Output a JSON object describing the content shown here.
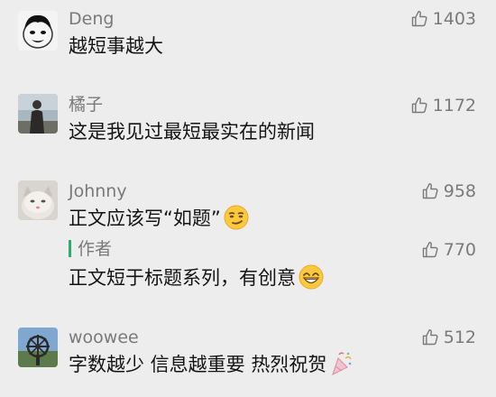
{
  "comments": [
    {
      "name": "Deng",
      "text": "越短事越大",
      "likes": "1403",
      "avatar": "meme-face-avatar"
    },
    {
      "name": "橘子",
      "text": "这是我见过最短最实在的新闻",
      "likes": "1172",
      "avatar": "person-photo-avatar"
    },
    {
      "name": "Johnny",
      "text": "正文应该写“如题”",
      "likes": "958",
      "avatar": "cat-photo-avatar",
      "emoji": "smirk-emoji"
    },
    {
      "name": "作者",
      "text": "正文短于标题系列，有创意",
      "likes": "770",
      "is_author_reply": true,
      "emoji": "grin-emoji"
    },
    {
      "name": "woowee",
      "text": "字数越少 信息越重要 热烈祝贺",
      "likes": "512",
      "avatar": "landscape-photo-avatar",
      "emoji": "party-popper-emoji"
    }
  ],
  "colors": {
    "background": "#ededed",
    "name": "#7a7a7a",
    "text": "#141414",
    "author_accent": "#2aae67"
  }
}
